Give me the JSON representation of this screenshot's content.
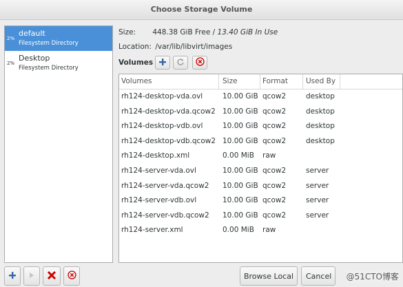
{
  "window": {
    "title": "Choose Storage Volume"
  },
  "pools": [
    {
      "percent": "2%",
      "name": "default",
      "type": "Filesystem Directory",
      "selected": true
    },
    {
      "percent": "2%",
      "name": "Desktop",
      "type": "Filesystem Directory",
      "selected": false
    }
  ],
  "details": {
    "size_label": "Size:",
    "free": "448.38 GiB Free",
    "separator": " / ",
    "in_use": "13.40 GiB In Use",
    "location_label": "Location:",
    "location": "/var/lib/libvirt/images"
  },
  "volumes_toolbar": {
    "label": "Volumes"
  },
  "table": {
    "headers": [
      "Volumes",
      "Size",
      "Format",
      "Used By"
    ],
    "rows": [
      {
        "name": "rh124-desktop-vda.ovl",
        "size": "10.00 GiB",
        "format": "qcow2",
        "used_by": "desktop"
      },
      {
        "name": "rh124-desktop-vda.qcow2",
        "size": "10.00 GiB",
        "format": "qcow2",
        "used_by": "desktop"
      },
      {
        "name": "rh124-desktop-vdb.ovl",
        "size": "10.00 GiB",
        "format": "qcow2",
        "used_by": "desktop"
      },
      {
        "name": "rh124-desktop-vdb.qcow2",
        "size": "10.00 GiB",
        "format": "qcow2",
        "used_by": "desktop"
      },
      {
        "name": "rh124-desktop.xml",
        "size": "0.00 MiB",
        "format": "raw",
        "used_by": ""
      },
      {
        "name": "rh124-server-vda.ovl",
        "size": "10.00 GiB",
        "format": "qcow2",
        "used_by": "server"
      },
      {
        "name": "rh124-server-vda.qcow2",
        "size": "10.00 GiB",
        "format": "qcow2",
        "used_by": "server"
      },
      {
        "name": "rh124-server-vdb.ovl",
        "size": "10.00 GiB",
        "format": "qcow2",
        "used_by": "server"
      },
      {
        "name": "rh124-server-vdb.qcow2",
        "size": "10.00 GiB",
        "format": "qcow2",
        "used_by": "server"
      },
      {
        "name": "rh124-server.xml",
        "size": "0.00 MiB",
        "format": "raw",
        "used_by": ""
      }
    ]
  },
  "buttons": {
    "browse_local": "Browse Local",
    "cancel": "Cancel"
  },
  "watermark": "@51CTO博客",
  "colors": {
    "selection": "#4a90d9",
    "add": "#3465a4",
    "delete": "#cc0000"
  }
}
